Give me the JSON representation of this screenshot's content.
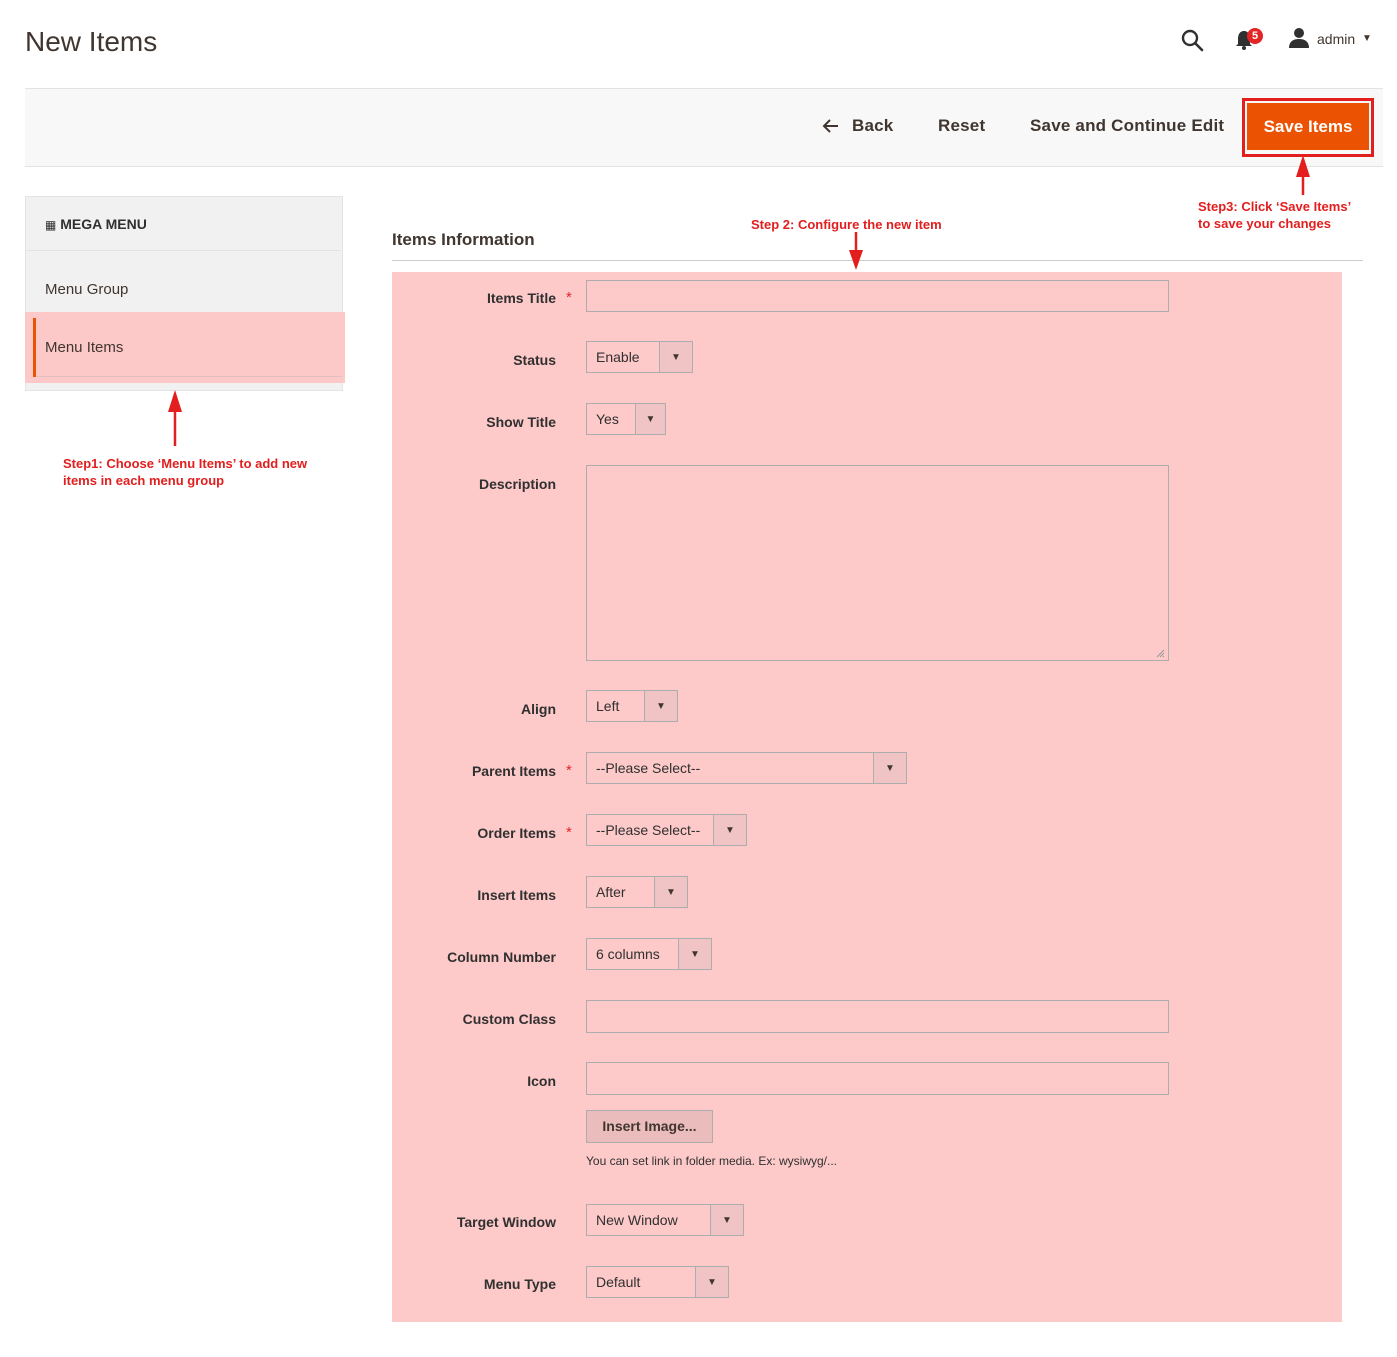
{
  "header": {
    "title": "New Items",
    "notification_count": "5",
    "user_name": "admin"
  },
  "actions": {
    "back": "Back",
    "reset": "Reset",
    "save_continue": "Save and Continue Edit",
    "save": "Save Items"
  },
  "sidebar": {
    "title": "MEGA MENU",
    "items": [
      {
        "label": "Menu Group"
      },
      {
        "label": "Menu Items"
      }
    ]
  },
  "form": {
    "section_title": "Items Information",
    "fields": {
      "items_title": {
        "label": "Items Title",
        "required": "*"
      },
      "status": {
        "label": "Status",
        "value": "Enable"
      },
      "show_title": {
        "label": "Show Title",
        "value": "Yes"
      },
      "description": {
        "label": "Description"
      },
      "align": {
        "label": "Align",
        "value": "Left"
      },
      "parent_items": {
        "label": "Parent Items",
        "required": "*",
        "value": "--Please Select--"
      },
      "order_items": {
        "label": "Order Items",
        "required": "*",
        "value": "--Please Select--"
      },
      "insert_items": {
        "label": "Insert Items",
        "value": "After"
      },
      "column_number": {
        "label": "Column Number",
        "value": "6 columns"
      },
      "custom_class": {
        "label": "Custom Class"
      },
      "icon": {
        "label": "Icon",
        "button": "Insert Image...",
        "note": "You can set link in folder media. Ex: wysiwyg/..."
      },
      "target_window": {
        "label": "Target Window",
        "value": "New Window"
      },
      "menu_type": {
        "label": "Menu Type",
        "value": "Default"
      }
    }
  },
  "annotations": {
    "step1_line1": "Step1: Choose ‘Menu Items’ to add new",
    "step1_line2": "items in each menu group",
    "step2": "Step 2: Configure the new item",
    "step3_line1": "Step3: Click ‘Save Items’",
    "step3_line2": "to save your changes"
  },
  "colors": {
    "accent": "#eb5202",
    "annotation": "#e21e1e",
    "highlight": "#fdc9c9"
  }
}
